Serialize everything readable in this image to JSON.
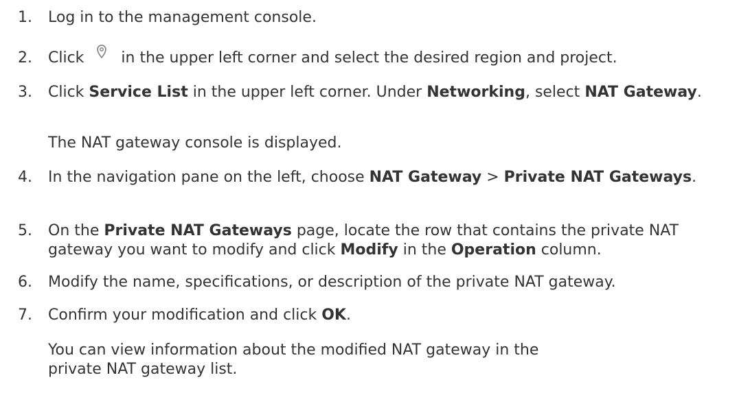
{
  "steps": [
    {
      "num": "1.",
      "parts": [
        {
          "t": "Log in to the management console."
        }
      ]
    },
    {
      "num": "2.",
      "parts": [
        {
          "t": "Click "
        },
        {
          "icon": "location-pin-icon"
        },
        {
          "t": " in the upper left corner and select the desired region and project."
        }
      ]
    },
    {
      "num": "3.",
      "parts": [
        {
          "t": "Click "
        },
        {
          "t": "Service List",
          "b": true
        },
        {
          "t": " in the upper left corner. Under "
        },
        {
          "t": "Networking",
          "b": true
        },
        {
          "t": ", select "
        },
        {
          "t": "NAT Gateway",
          "b": true
        },
        {
          "t": "."
        }
      ],
      "result": "The NAT gateway console is displayed."
    },
    {
      "num": "4.",
      "parts": [
        {
          "t": "In the navigation pane on the left, choose "
        },
        {
          "t": "NAT Gateway",
          "b": true
        },
        {
          "t": " > "
        },
        {
          "t": "Private NAT Gateways",
          "b": true
        },
        {
          "t": "."
        }
      ]
    },
    {
      "num": "5.",
      "parts": [
        {
          "t": "On the "
        },
        {
          "t": "Private NAT Gateways",
          "b": true
        },
        {
          "t": " page, locate the row that contains the private NAT gateway you want to modify and click "
        },
        {
          "t": "Modify",
          "b": true
        },
        {
          "t": " in the "
        },
        {
          "t": "Operation",
          "b": true
        },
        {
          "t": " column."
        }
      ]
    },
    {
      "num": "6.",
      "parts": [
        {
          "t": "Modify the name, specifications, or description of the private NAT gateway."
        }
      ]
    },
    {
      "num": "7.",
      "parts": [
        {
          "t": "Confirm your modification and click "
        },
        {
          "t": "OK",
          "b": true
        },
        {
          "t": "."
        }
      ],
      "result": "You can view information about the modified NAT gateway in the private NAT gateway list."
    }
  ]
}
